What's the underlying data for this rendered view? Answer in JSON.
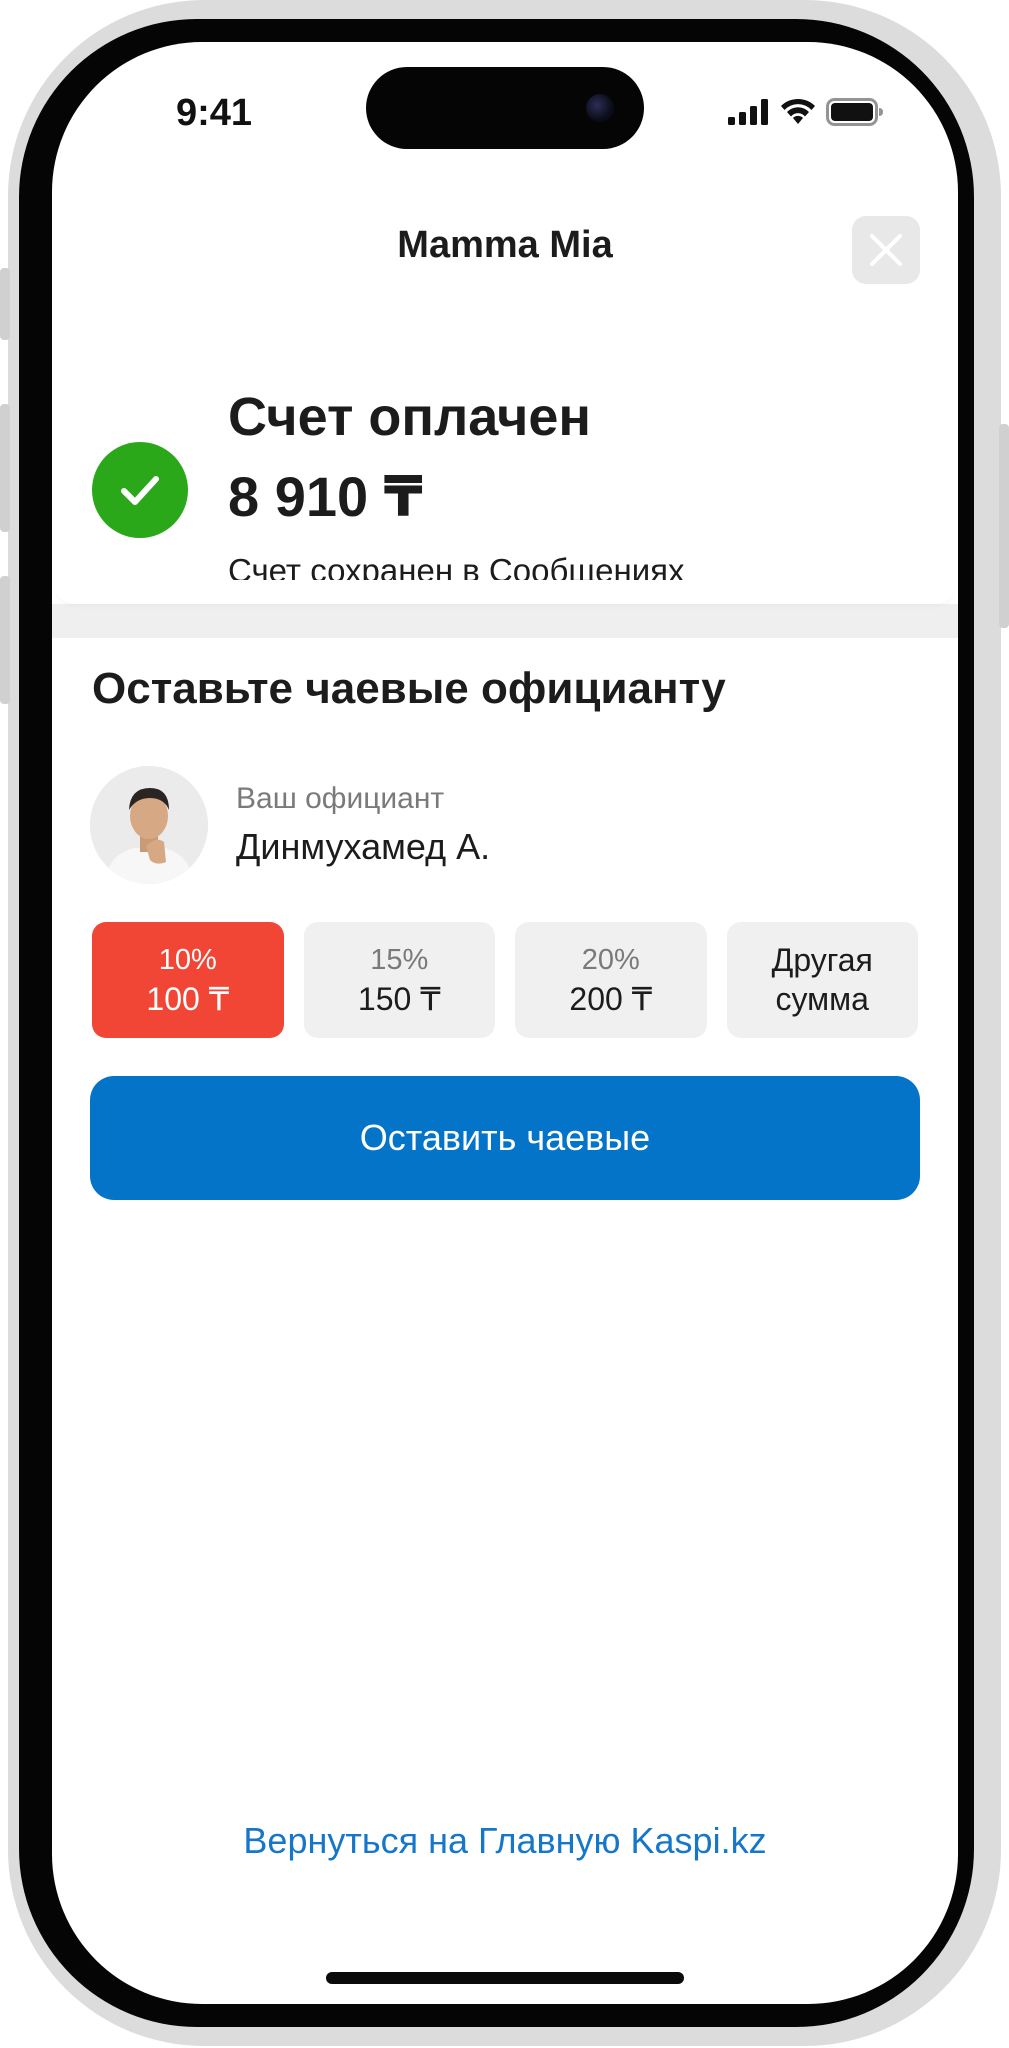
{
  "status_bar": {
    "time": "9:41",
    "icons": [
      "cellular-signal-icon",
      "wifi-icon",
      "battery-icon"
    ]
  },
  "header": {
    "title": "Mamma Mia",
    "close_icon": "close-icon"
  },
  "payment": {
    "status_icon": "check-icon",
    "title": "Счет оплачен",
    "amount": "8 910 ₸",
    "note": "Счет сохранен в Сообщениях"
  },
  "tips": {
    "heading": "Оставьте чаевые официанту",
    "waiter": {
      "caption": "Ваш официант",
      "name": "Динмухамед А."
    },
    "options": [
      {
        "percent": "10%",
        "amount": "100 ₸",
        "selected": true
      },
      {
        "percent": "15%",
        "amount": "150 ₸",
        "selected": false
      },
      {
        "percent": "20%",
        "amount": "200 ₸",
        "selected": false
      },
      {
        "label": "Другая сумма",
        "selected": false
      }
    ],
    "submit_label": "Оставить чаевые"
  },
  "footer": {
    "home_link": "Вернуться на Главную Kaspi.kz"
  },
  "colors": {
    "accent_red": "#f14635",
    "primary_blue": "#0474c9",
    "link_blue": "#1677c9",
    "success_green": "#2aa81a"
  }
}
